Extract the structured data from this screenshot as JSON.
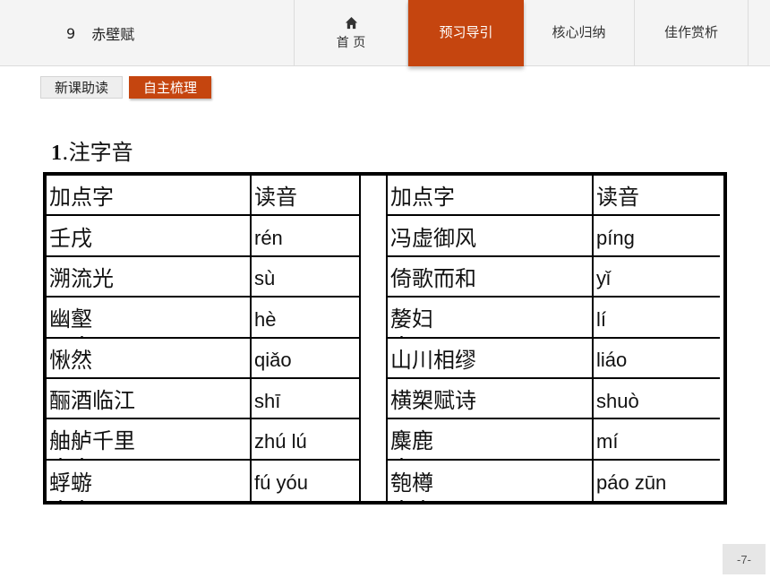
{
  "header": {
    "lesson_number": "9",
    "lesson_title": "赤壁赋",
    "home_label": "首 页",
    "tabs": [
      {
        "label": "预习导引",
        "active": true
      },
      {
        "label": "核心归纳",
        "active": false
      },
      {
        "label": "佳作赏析",
        "active": false
      }
    ]
  },
  "subtabs": [
    {
      "label": "新课助读",
      "active": false
    },
    {
      "label": "自主梳理",
      "active": true
    }
  ],
  "section": {
    "number": "1",
    "title": ".注字音"
  },
  "table": {
    "headers": [
      "加点字",
      "读音",
      "加点字",
      "读音"
    ],
    "left": [
      {
        "word": "壬戌",
        "dots": [
          0
        ],
        "reading": "rén"
      },
      {
        "word": "溯流光",
        "dots": [
          0
        ],
        "reading": "sù"
      },
      {
        "word": "幽壑",
        "dots": [
          1
        ],
        "reading": "hè"
      },
      {
        "word": "愀然",
        "dots": [
          0
        ],
        "reading": "qiǎo"
      },
      {
        "word": "酾酒临江",
        "dots": [
          0
        ],
        "reading": "shī"
      },
      {
        "word": "舳舻千里",
        "dots": [
          0,
          1
        ],
        "reading": "zhú lú"
      },
      {
        "word": "蜉蝣",
        "dots": [
          0,
          1
        ],
        "reading": "fú yóu"
      }
    ],
    "right": [
      {
        "word": "冯虚御风",
        "dots": [
          0
        ],
        "reading": "píng"
      },
      {
        "word": "倚歌而和",
        "dots": [
          0
        ],
        "reading": "yǐ"
      },
      {
        "word": "嫠妇",
        "dots": [
          0
        ],
        "reading": "lí"
      },
      {
        "word": "山川相缪",
        "dots": [
          3
        ],
        "reading": "liáo"
      },
      {
        "word": "横槊赋诗",
        "dots": [
          1
        ],
        "reading": "shuò"
      },
      {
        "word": "麋鹿",
        "dots": [
          0
        ],
        "reading": "mí"
      },
      {
        "word": "匏樽",
        "dots": [
          0,
          1
        ],
        "reading": "páo zūn"
      }
    ]
  },
  "page_number": "-7-",
  "colors": {
    "accent": "#c5450f",
    "nav_bg": "#f4f4f4"
  },
  "icons": {
    "home": "home-icon"
  }
}
